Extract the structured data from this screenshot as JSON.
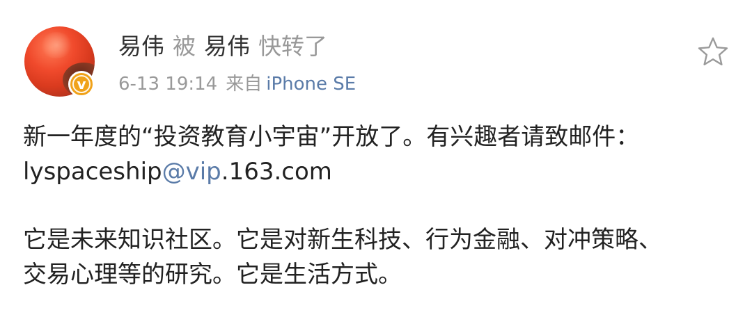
{
  "post": {
    "author": "易伟",
    "via_word": "被",
    "reposter": "易伟",
    "action": "快转了",
    "date": "6-13 19:14",
    "source_prefix": "来自",
    "source": "iPhone SE",
    "badge": "v",
    "body": {
      "line1": "新一年度的“投资教育小宇宙”开放了。有兴趣者请致邮件：",
      "email_user": "lyspaceship",
      "email_link": "@vip",
      "email_domain": ".163.com",
      "line3": "它是未来知识社区。它是对新生科技、行为金融、对冲策略、",
      "line4": "交易心理等的研究。它是生活方式。"
    }
  },
  "icons": {
    "favorite": "star-icon",
    "verified": "vip-badge-icon"
  },
  "colors": {
    "link": "#5a7ba8",
    "muted": "#999999",
    "text": "#222222",
    "badge": "#f0a21a",
    "avatar": "#e8452a"
  }
}
